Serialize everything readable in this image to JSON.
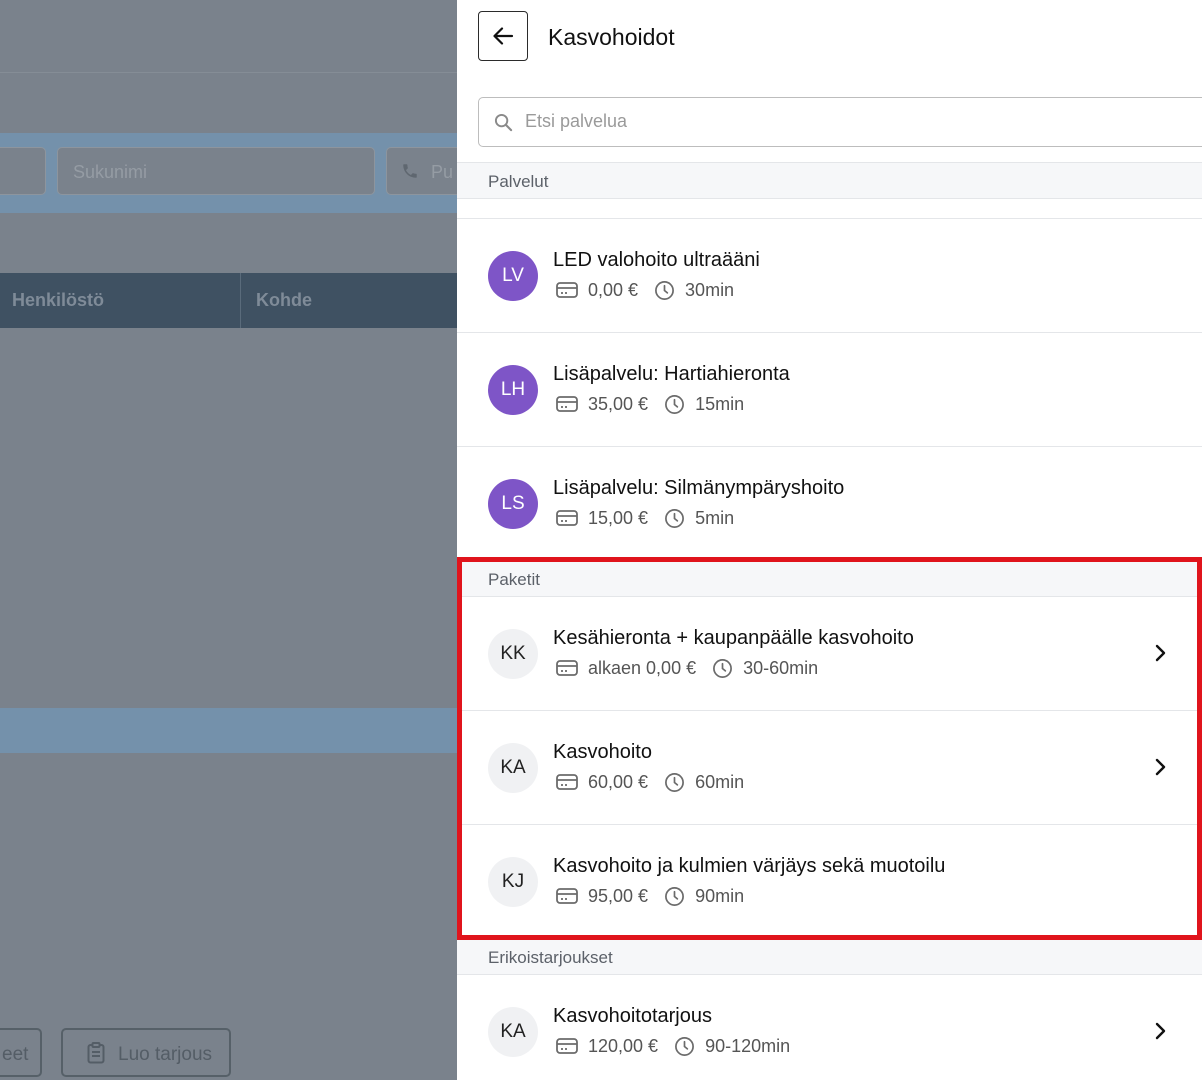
{
  "background": {
    "fields": {
      "lastname_placeholder": "Sukunimi",
      "phone_placeholder": "Pu"
    },
    "table_headers": [
      "Henkilöstö",
      "Kohde"
    ],
    "buttons": {
      "partial_label": "eet",
      "create_offer_label": "Luo tarjous"
    }
  },
  "panel": {
    "title": "Kasvohoidot",
    "search_placeholder": "Etsi palvelua",
    "sections": {
      "services": {
        "label": "Palvelut",
        "items": [
          {
            "initials": "LV",
            "name": "LED valohoito ultraääni",
            "price": "0,00 €",
            "duration": "30min"
          },
          {
            "initials": "LH",
            "name": "Lisäpalvelu: Hartiahieronta",
            "price": "35,00 €",
            "duration": "15min"
          },
          {
            "initials": "LS",
            "name": "Lisäpalvelu: Silmänympäryshoito",
            "price": "15,00 €",
            "duration": "5min"
          }
        ]
      },
      "packages": {
        "label": "Paketit",
        "items": [
          {
            "initials": "KK",
            "name": "Kesähieronta + kaupanpäälle kasvohoito",
            "price": "alkaen 0,00 €",
            "duration": "30-60min"
          },
          {
            "initials": "KA",
            "name": "Kasvohoito",
            "price": "60,00 €",
            "duration": "60min"
          },
          {
            "initials": "KJ",
            "name": "Kasvohoito ja kulmien värjäys sekä muotoilu",
            "price": "95,00 €",
            "duration": "90min"
          }
        ]
      },
      "offers": {
        "label": "Erikoistarjoukset",
        "items": [
          {
            "initials": "KA",
            "name": "Kasvohoitotarjous",
            "price": "120,00 €",
            "duration": "90-120min"
          }
        ]
      }
    }
  },
  "colors": {
    "avatar_purple": "#7e55c7",
    "highlight_red": "#e0141c",
    "overlay": "#7a828c"
  }
}
